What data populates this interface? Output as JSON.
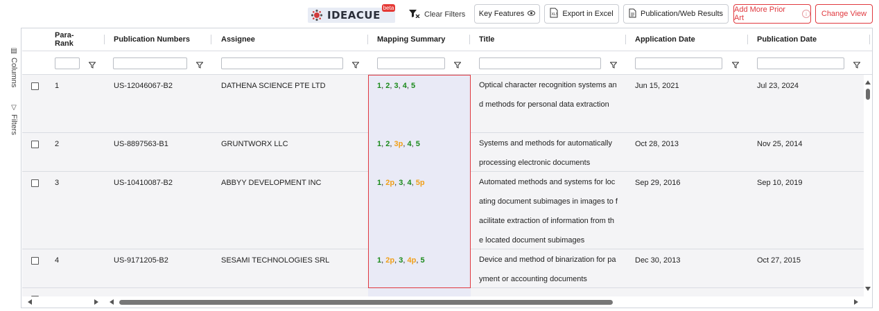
{
  "toolbar": {
    "logo_text": "IDEACUE",
    "beta_label": "beta",
    "clear_filters_label": "Clear Filters",
    "key_features_label": "Key Features",
    "export_label": "Export in Excel",
    "publication_results_label": "Publication/Web Results",
    "add_prior_art_label": "Add More Prior Art",
    "change_view_label": "Change View"
  },
  "side": {
    "columns_label": "Columns",
    "filters_label": "Filters"
  },
  "table": {
    "headers": [
      "Para-\nRank",
      "Publication Numbers",
      "Assignee",
      "Mapping Summary",
      "Title",
      "Application Date",
      "Publication Date"
    ],
    "rows": [
      {
        "rank": "1",
        "publication": "US-12046067-B2",
        "assignee": "DATHENA SCIENCE PTE LTD",
        "mapping": [
          {
            "text": "1",
            "color": "green"
          },
          {
            "text": "2",
            "color": "green"
          },
          {
            "text": "3",
            "color": "green"
          },
          {
            "text": "4",
            "color": "green"
          },
          {
            "text": "5",
            "color": "green"
          }
        ],
        "title": "Optical character recognition systems and methods for personal data extraction",
        "application_date": "Jun 15, 2021",
        "publication_date": "Jul 23, 2024"
      },
      {
        "rank": "2",
        "publication": "US-8897563-B1",
        "assignee": "GRUNTWORX LLC",
        "mapping": [
          {
            "text": "1",
            "color": "green"
          },
          {
            "text": "2",
            "color": "green"
          },
          {
            "text": "3p",
            "color": "orange"
          },
          {
            "text": "4",
            "color": "green"
          },
          {
            "text": "5",
            "color": "green"
          }
        ],
        "title": "Systems and methods for automatically processing electronic documents",
        "application_date": "Oct 28, 2013",
        "publication_date": "Nov 25, 2014"
      },
      {
        "rank": "3",
        "publication": "US-10410087-B2",
        "assignee": "ABBYY DEVELOPMENT INC",
        "mapping": [
          {
            "text": "1",
            "color": "green"
          },
          {
            "text": "2p",
            "color": "orange"
          },
          {
            "text": "3",
            "color": "green"
          },
          {
            "text": "4",
            "color": "green"
          },
          {
            "text": "5p",
            "color": "orange"
          }
        ],
        "title": "Automated methods and systems for locating document subimages in images to facilitate extraction of information from the located document subimages",
        "application_date": "Sep 29, 2016",
        "publication_date": "Sep 10, 2019"
      },
      {
        "rank": "4",
        "publication": "US-9171205-B2",
        "assignee": "SESAMI TECHNOLOGIES SRL",
        "mapping": [
          {
            "text": "1",
            "color": "green"
          },
          {
            "text": "2p",
            "color": "orange"
          },
          {
            "text": "3",
            "color": "green"
          },
          {
            "text": "4p",
            "color": "orange"
          },
          {
            "text": "5",
            "color": "green"
          }
        ],
        "title": "Device and method of binarization for payment or accounting documents",
        "application_date": "Dec 30, 2013",
        "publication_date": "Oct 27, 2015"
      }
    ]
  },
  "colors": {
    "green": "#1b8a1b",
    "orange": "#f0a01a",
    "accent_red": "#e0383e",
    "mapping_bg": "#e9eaf6",
    "row_bg": "#f4f4f6"
  }
}
